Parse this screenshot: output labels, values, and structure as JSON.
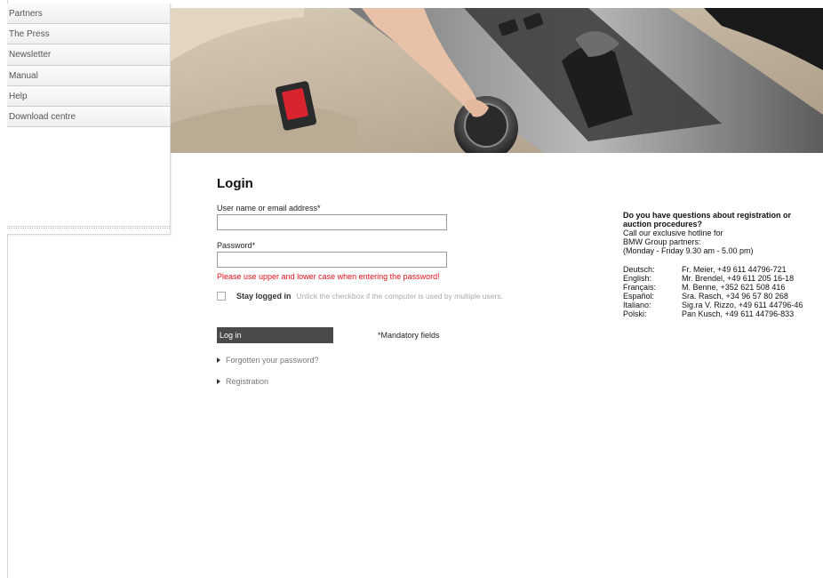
{
  "sidebar": {
    "items": [
      {
        "label": "Partners"
      },
      {
        "label": "The Press"
      },
      {
        "label": "Newsletter"
      },
      {
        "label": "Manual"
      },
      {
        "label": "Help"
      },
      {
        "label": "Download centre"
      }
    ]
  },
  "login": {
    "title": "Login",
    "username_label": "User name or email address*",
    "username_value": "",
    "password_label": "Password*",
    "password_value": "",
    "password_hint": "Please use upper and lower case when entering the password!",
    "stay_logged_in_label": "Stay logged in",
    "stay_logged_in_help": "Untick the checkbox if the computer is used by multiple users.",
    "stay_logged_in_checked": false,
    "login_button": "Log in",
    "mandatory_note": "*Mandatory fields",
    "forgot_link": "Forgotten your password?",
    "registration_link": "Registration"
  },
  "info": {
    "heading_line1": "Do you have questions about registration or",
    "heading_line2": "auction procedures?",
    "line1": "Call our exclusive hotline for",
    "line2": "BMW Group partners:",
    "line3": "(Monday - Friday 9.30 am - 5.00 pm)",
    "hotlines": [
      {
        "lang": "Deutsch:",
        "contact": "Fr. Meier, +49 611 44796-721"
      },
      {
        "lang": "English:",
        "contact": "Mr. Brendel, +49 611 205 16-18"
      },
      {
        "lang": "Français:",
        "contact": "M. Benne, +352 621 508 416"
      },
      {
        "lang": "Español:",
        "contact": "Sra. Rasch, +34 96 57 80 268"
      },
      {
        "lang": "Italiano:",
        "contact": "Sig.ra V. Rizzo, +49 611 44796-46"
      },
      {
        "lang": "Polski:",
        "contact": "Pan Kusch, +49 611 44796-833"
      }
    ]
  },
  "colors": {
    "accent_red": "#e0121b",
    "button_bg": "#4a4a4a"
  }
}
